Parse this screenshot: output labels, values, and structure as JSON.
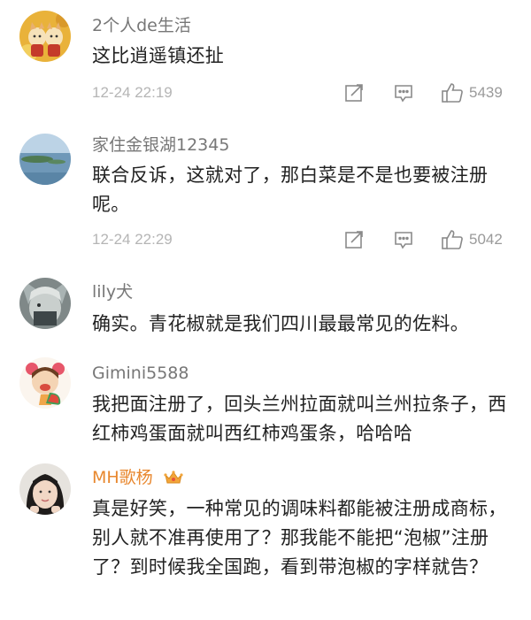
{
  "comments": [
    {
      "username": "2个人de生活",
      "text": "这比逍遥镇还扯",
      "time": "12-24 22:19",
      "likes": "5439",
      "avatar": "dog-avatar"
    },
    {
      "username": "家住金银湖12345",
      "text": "联合反诉，这就对了，那白菜是不是也要被注册呢。",
      "time": "12-24 22:29",
      "likes": "5042",
      "avatar": "lake-avatar"
    },
    {
      "username": "lily犬",
      "text": "确实。青花椒就是我们四川最最常见的佐料。",
      "avatar": "anime-avatar"
    },
    {
      "username": "Gimini5588",
      "text": "我把面注册了，回头兰州拉面就叫兰州拉条子，西红柿鸡蛋面就叫西红柿鸡蛋条，哈哈哈",
      "avatar": "cartoon-girl-avatar"
    },
    {
      "username": "MH歌杨",
      "text": "真是好笑，一种常见的调味料都能被注册成商标，别人就不准再使用了？那我能不能把“泡椒”注册了？到时候我全国跑，看到带泡椒的字样就告？",
      "avatar": "photo-avatar",
      "vip": true
    }
  ],
  "colors": {
    "username": "#777777",
    "vip_username": "#e8872e",
    "text": "#222222",
    "meta": "#b5b5b5"
  },
  "icons": [
    "share-icon",
    "comment-icon",
    "like-icon",
    "crown-icon"
  ]
}
